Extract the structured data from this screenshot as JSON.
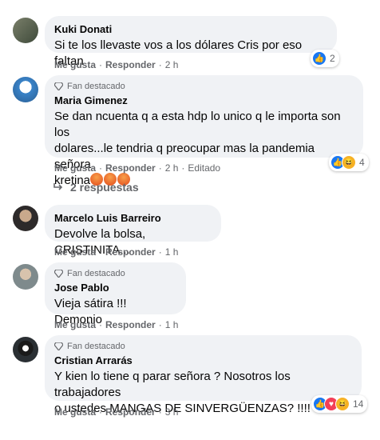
{
  "comments": [
    {
      "name": "Kuki Donati",
      "text": "Si te los llevaste vos a los dólares Cris por eso faltan",
      "like": "Me gusta",
      "reply": "Responder",
      "time": "2 h",
      "reaction_count": "2",
      "reactions": [
        "like-icon"
      ]
    },
    {
      "badge": "Fan destacado",
      "name": "Maria Gimenez",
      "text_lines": [
        "Se dan ncuenta q a esta hdp lo unico q le importa son los",
        "dolares...le tendria q preocupar mas la pandemia señora",
        "kretina"
      ],
      "like": "Me gusta",
      "reply": "Responder",
      "time": "2 h",
      "edited": "Editado",
      "reaction_count": "4",
      "reactions": [
        "like-icon",
        "haha-icon"
      ],
      "replies_label": "2 respuestas"
    },
    {
      "name": "Marcelo Luis Barreiro",
      "text": "Devolve la bolsa, CRISTINITA...",
      "like": "Me gusta",
      "reply": "Responder",
      "time": "1 h"
    },
    {
      "badge": "Fan destacado",
      "name": "Jose Pablo",
      "text": "Vieja sátira !!! Demonio",
      "like": "Me gusta",
      "reply": "Responder",
      "time": "1 h"
    },
    {
      "badge": "Fan destacado",
      "name": "Cristian Arrarás",
      "text_lines": [
        "Y kien lo tiene q parar señora ? Nosotros los trabajadores",
        "o ustedes MANGAS DE SINVERGÜENZAS? !!!!"
      ],
      "like": "Me gusta",
      "reply": "Responder",
      "time": "3 h",
      "reaction_count": "14",
      "reactions": [
        "like-icon",
        "love-icon",
        "haha-icon"
      ]
    }
  ],
  "colors": {
    "bubble": "#f0f2f5",
    "meta": "#65676b",
    "like": "#1877f2",
    "love": "#f33e58",
    "haha": "#f7b125"
  }
}
